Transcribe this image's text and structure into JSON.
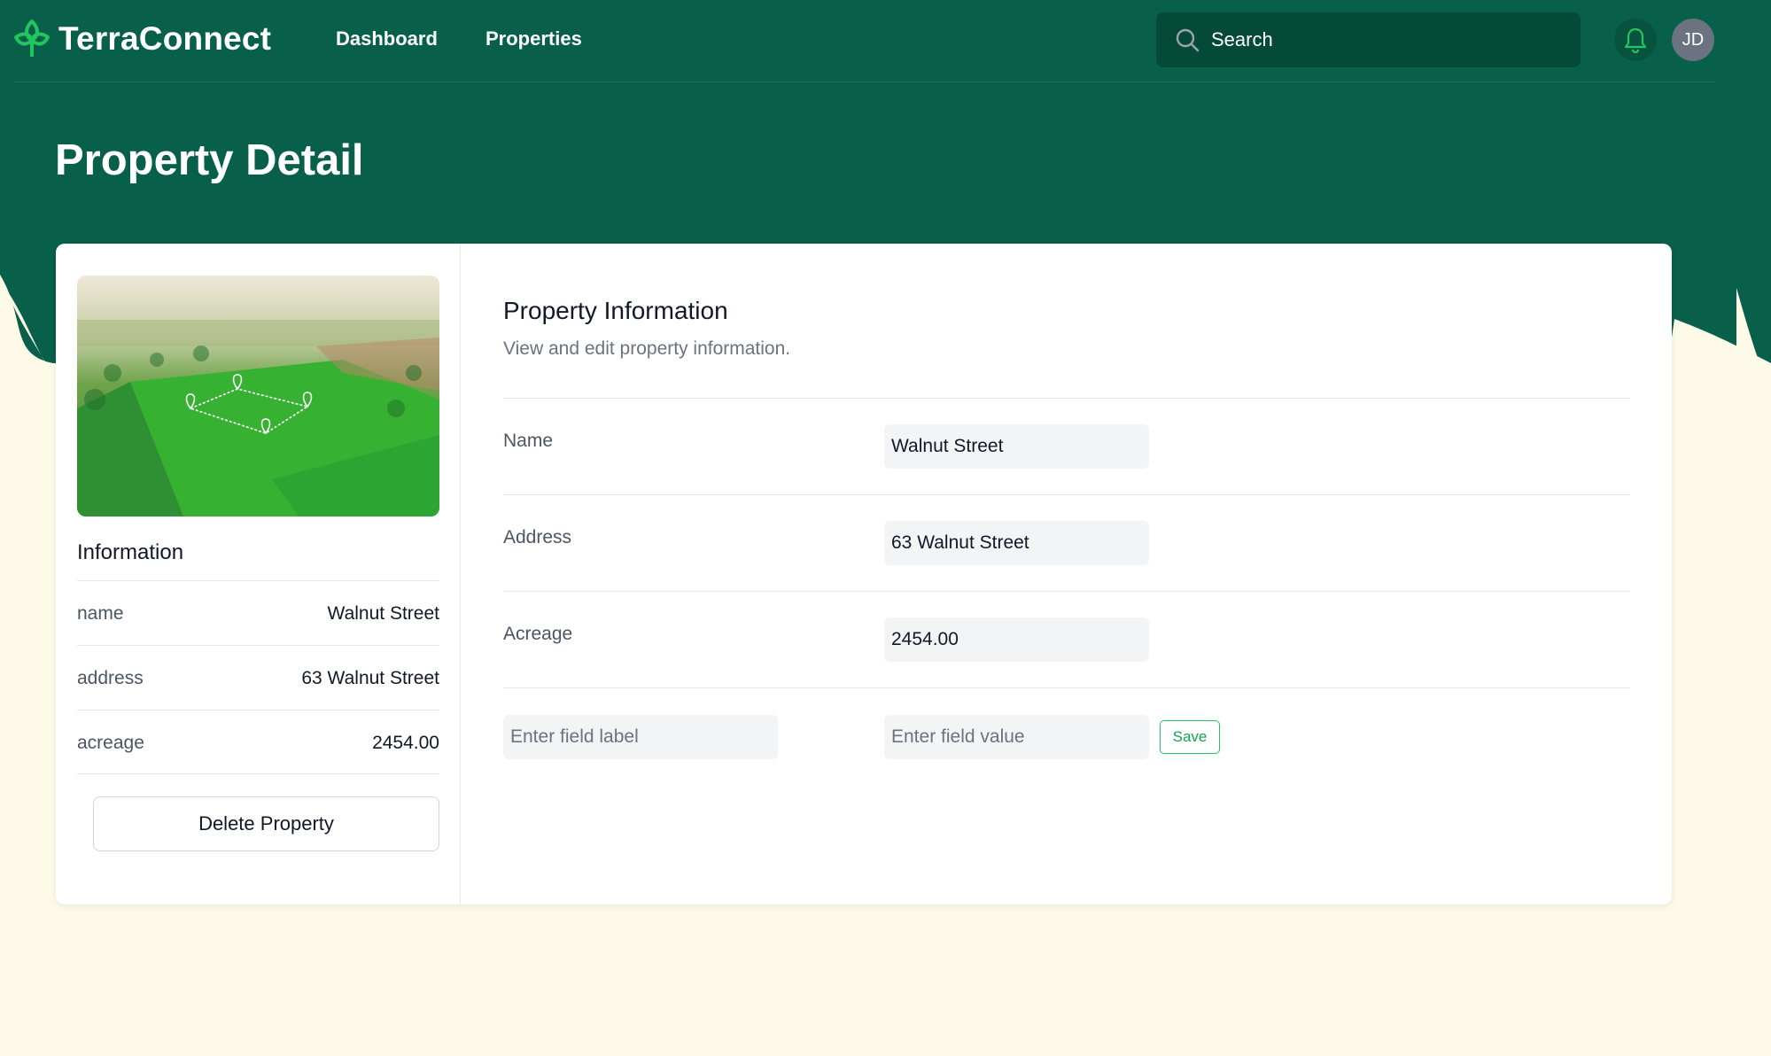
{
  "app": {
    "name": "TerraConnect"
  },
  "nav": {
    "links": [
      {
        "label": "Dashboard"
      },
      {
        "label": "Properties"
      }
    ],
    "search_placeholder": "Search",
    "avatar_initials": "JD"
  },
  "page": {
    "title": "Property Detail"
  },
  "information": {
    "title": "Information",
    "rows": [
      {
        "key": "name",
        "value": "Walnut Street"
      },
      {
        "key": "address",
        "value": "63 Walnut Street"
      },
      {
        "key": "acreage",
        "value": "2454.00"
      }
    ],
    "delete_label": "Delete Property"
  },
  "property_info": {
    "title": "Property Information",
    "subtitle": "View and edit property information.",
    "fields": [
      {
        "label": "Name",
        "value": "Walnut Street"
      },
      {
        "label": "Address",
        "value": "63 Walnut Street"
      },
      {
        "label": "Acreage",
        "value": "2454.00"
      }
    ],
    "new_field": {
      "label_placeholder": "Enter field label",
      "value_placeholder": "Enter field value",
      "save_label": "Save"
    }
  },
  "colors": {
    "header_green": "#08604a",
    "search_bg": "#054a37",
    "page_bg": "#fdfae8",
    "logo_green": "#22c55e",
    "save_green": "#16a34a"
  },
  "icons": [
    "leaf-logo-icon",
    "search-icon",
    "bell-icon",
    "map-pin-icon"
  ]
}
